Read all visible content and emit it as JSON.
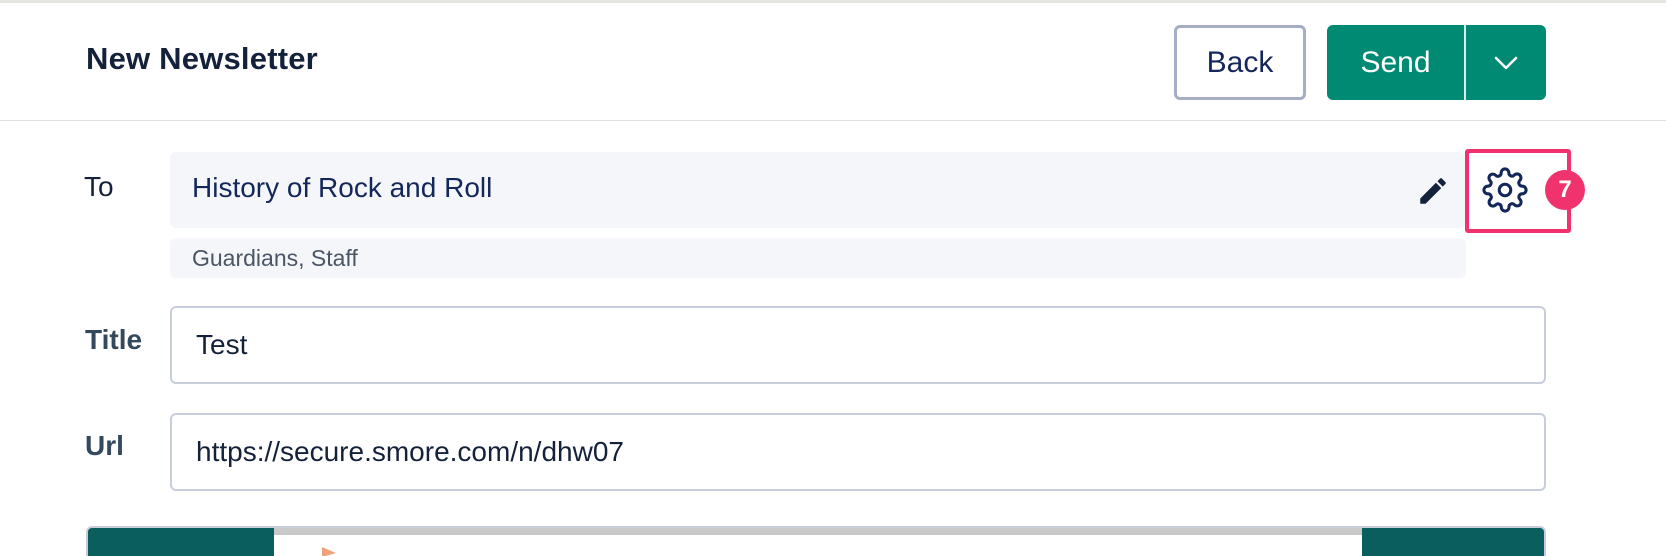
{
  "header": {
    "title": "New Newsletter",
    "back_label": "Back",
    "send_label": "Send",
    "send_menu_icon": "chevron-down-icon"
  },
  "form": {
    "to": {
      "label": "To",
      "value": "History of Rock and Roll",
      "groups": "Guardians, Staff",
      "edit_icon": "pencil-icon",
      "settings_icon": "gear-icon",
      "settings_badge": "7"
    },
    "title": {
      "label": "Title",
      "value": "Test"
    },
    "url": {
      "label": "Url",
      "value": "https://secure.smore.com/n/dhw07"
    }
  },
  "colors": {
    "primary": "#008a73",
    "highlight": "#f0336e",
    "preview_dark": "#0a5e5e"
  }
}
